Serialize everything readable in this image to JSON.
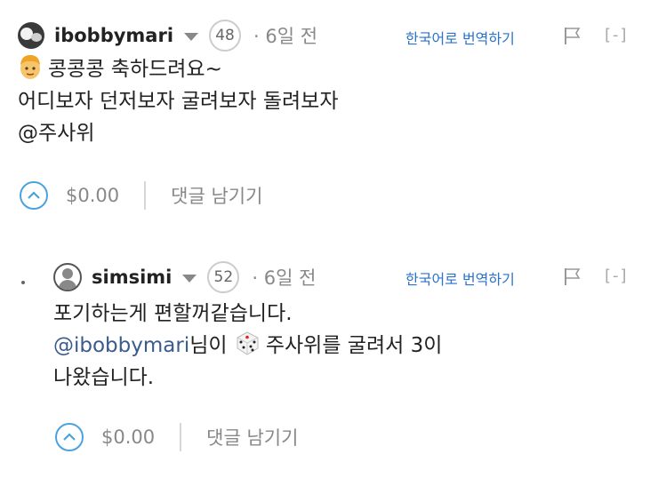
{
  "comments": [
    {
      "username": "ibobbymari",
      "reputation": "48",
      "time_ago": "· 6일 전",
      "translate_label": "한국어로 번역하기",
      "collapse_label": "[-]",
      "lines": [
        "콩콩콩 축하드려요~",
        "어디보자 던저보자 굴려보자 돌려보자",
        "@주사위"
      ],
      "payout": "$0.00",
      "reply_label": "댓글 남기기"
    },
    {
      "username": "simsimi",
      "reputation": "52",
      "time_ago": "· 6일 전",
      "translate_label": "한국어로 번역하기",
      "collapse_label": "[-]",
      "line1": "포기하는게 편할꺼같습니다.",
      "mention": "@ibobbymari",
      "line2_rest": "님이",
      "line2_after_dice": "주사위를 굴려서 3이",
      "line3": "나왔습니다.",
      "payout": "$0.00",
      "reply_label": "댓글 남기기"
    }
  ],
  "icons": [
    "caret-down-icon",
    "flag-icon",
    "upvote-chevron-icon",
    "dice-icon",
    "person-face-emoji-icon"
  ],
  "colors": {
    "link": "#2a73c8",
    "mention": "#3b5b8c",
    "vote": "#4aa3df",
    "muted": "#888888"
  }
}
